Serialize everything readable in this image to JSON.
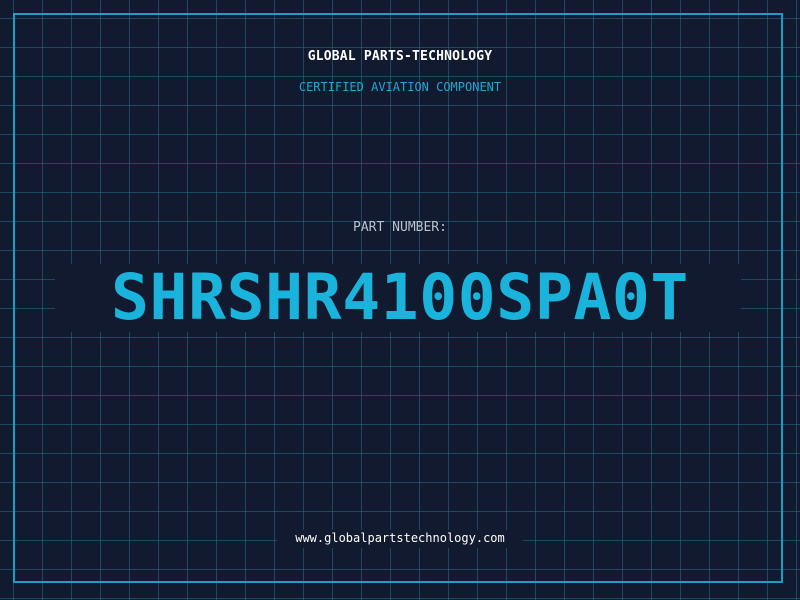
{
  "header": {
    "company": "GLOBAL PARTS-TECHNOLOGY",
    "subtitle": "CERTIFIED AVIATION COMPONENT"
  },
  "part": {
    "label": "PART NUMBER:",
    "number": "SHRSHR4100SPA0T"
  },
  "footer": {
    "website": "www.globalpartstechnology.com"
  },
  "colors": {
    "background": "#111a2e",
    "grid": "#256e8c",
    "frame": "#1a9ec4",
    "accent": "#1ab3dc",
    "text": "#ffffff"
  }
}
